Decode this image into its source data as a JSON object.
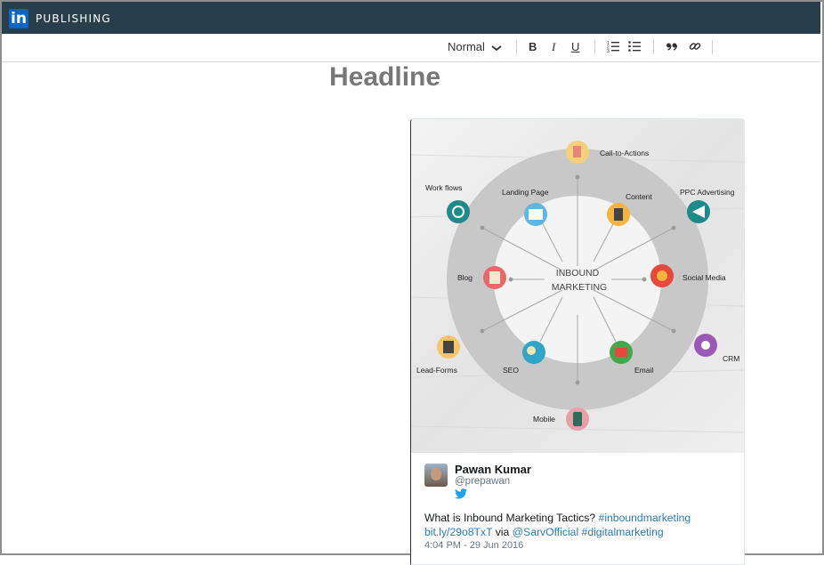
{
  "header": {
    "logo_text": "in",
    "brand_label": "PUBLISHING"
  },
  "toolbar": {
    "format_select": "Normal",
    "icons": [
      "bold-icon",
      "italic-icon",
      "underline-icon",
      "ordered-list-icon",
      "unordered-list-icon",
      "quote-icon",
      "link-icon"
    ],
    "bold": "B",
    "italic": "I",
    "underline": "U"
  },
  "editor": {
    "headline": "Headline"
  },
  "infographic": {
    "center_line1": "INBOUND",
    "center_line2": "MARKETING",
    "labels": {
      "call_to_actions": "Call-to-Actions",
      "work_flows": "Work flows",
      "landing_page": "Landing Page",
      "content": "Content",
      "ppc": "PPC Advertising",
      "blog": "Blog",
      "social_media": "Social Media",
      "lead_forms": "Lead-Forms",
      "seo": "SEO",
      "email": "Email",
      "crm": "CRM",
      "mobile": "Mobile"
    }
  },
  "tweet": {
    "name": "Pawan Kumar",
    "handle": "@prepawan",
    "text_plain1": "What is Inbound Marketing Tactics? ",
    "hashtag1": "#inboundmarketing",
    "link": "bit.ly/29o8TxT",
    "via": " via ",
    "mention": "@SarvOfficial",
    "space": " ",
    "hashtag2": "#digitalmarketing",
    "date": "4:04 PM - 29 Jun 2016"
  },
  "colors": {
    "topbar": "#283e4a",
    "linkedin_blue": "#0a66c2",
    "twitter_blue": "#1da1f2",
    "link": "#2b7bb9"
  }
}
